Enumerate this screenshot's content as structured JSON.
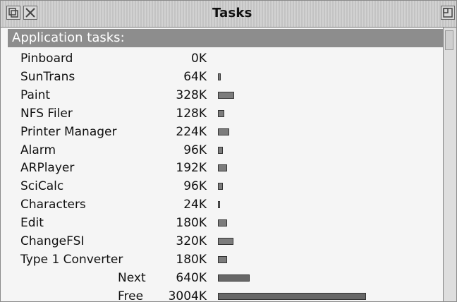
{
  "window": {
    "title": "Tasks"
  },
  "header": {
    "label": "Application tasks:"
  },
  "tasks": [
    {
      "name": "Pinboard",
      "memory": "0K",
      "kb": 0
    },
    {
      "name": "SunTrans",
      "memory": "64K",
      "kb": 64
    },
    {
      "name": "Paint",
      "memory": "328K",
      "kb": 328
    },
    {
      "name": "NFS Filer",
      "memory": "128K",
      "kb": 128
    },
    {
      "name": "Printer Manager",
      "memory": "224K",
      "kb": 224
    },
    {
      "name": "Alarm",
      "memory": "96K",
      "kb": 96
    },
    {
      "name": "ARPlayer",
      "memory": "192K",
      "kb": 192
    },
    {
      "name": "SciCalc",
      "memory": "96K",
      "kb": 96
    },
    {
      "name": "Characters",
      "memory": "24K",
      "kb": 24
    },
    {
      "name": "Edit",
      "memory": "180K",
      "kb": 180
    },
    {
      "name": "ChangeFSI",
      "memory": "320K",
      "kb": 320
    },
    {
      "name": "Type 1 Converter",
      "memory": "180K",
      "kb": 180
    }
  ],
  "summary": [
    {
      "name": "Next",
      "memory": "640K",
      "kb": 640
    },
    {
      "name": "Free",
      "memory": "3004K",
      "kb": 3004
    }
  ],
  "icons": {
    "back": "back-icon",
    "close": "close-icon",
    "toggle": "toggle-size-icon"
  }
}
